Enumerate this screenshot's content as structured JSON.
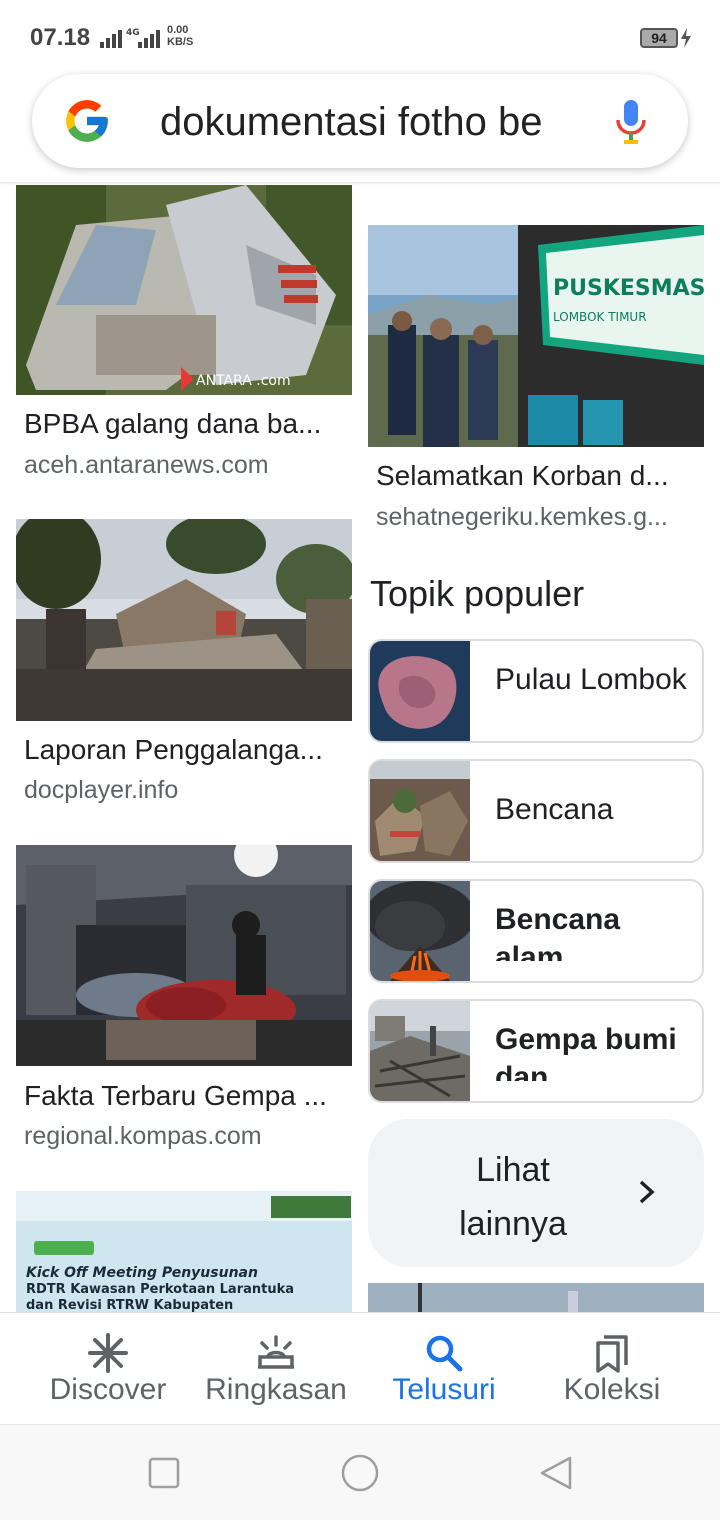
{
  "status_bar": {
    "time": "07.18",
    "network_type": "4G",
    "speed_value": "0.00",
    "speed_unit": "KB/S",
    "battery": "94"
  },
  "search": {
    "query": "dokumentasi fotho be"
  },
  "left_column": [
    {
      "title": "BPBA galang dana ba...",
      "source": "aceh.antaranews.com",
      "watermark": "ANTARA .com"
    },
    {
      "title": "Laporan Penggalanga...",
      "source": "docplayer.info"
    },
    {
      "title": "Fakta Terbaru Gempa ...",
      "source": "regional.kompas.com"
    },
    {
      "title": "",
      "source": "",
      "partial_image_text": "Kick Off Meeting Penyusunan RDTR Kawasan Perkotaan Larantuka dan Revisi RTRW Kabupaten"
    }
  ],
  "right_column": [
    {
      "title": "Selamatkan Korban d...",
      "source": "sehatnegeriku.kemkes.g...",
      "sign_text": "POSKO KESEHATAN PUSKESMAS BELANTING KABUPATEN LOMBOK TIMUR"
    }
  ],
  "popular_topics": {
    "title": "Topik populer",
    "items": [
      {
        "label": "Pulau Lombok"
      },
      {
        "label": "Bencana"
      },
      {
        "label": "Bencana alam"
      },
      {
        "label": "Gempa bumi dan"
      }
    ],
    "more_label": "Lihat lainnya"
  },
  "bottom_nav": {
    "items": [
      {
        "label": "Discover",
        "icon": "asterisk-icon"
      },
      {
        "label": "Ringkasan",
        "icon": "sunrise-icon"
      },
      {
        "label": "Telusuri",
        "icon": "search-icon",
        "active": true
      },
      {
        "label": "Koleksi",
        "icon": "bookmarks-icon"
      }
    ],
    "active_color": "#1a73e8"
  }
}
